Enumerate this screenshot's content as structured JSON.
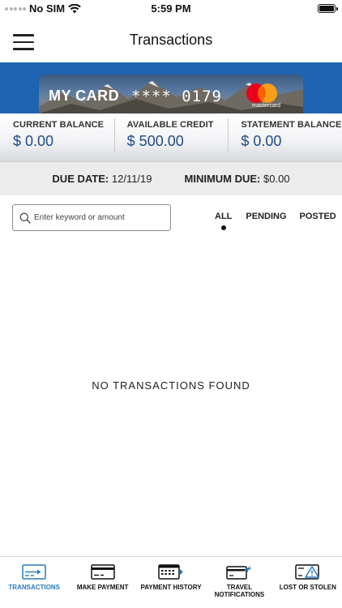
{
  "status_bar": {
    "carrier": "No SIM",
    "time": "5:59 PM"
  },
  "header": {
    "title": "Transactions"
  },
  "card": {
    "name": "MY CARD",
    "masked_prefix": "****",
    "last4": "0179",
    "network": "mastercard"
  },
  "balances": [
    {
      "label": "CURRENT BALANCE",
      "value": "$ 0.00"
    },
    {
      "label": "AVAILABLE CREDIT",
      "value": "$ 500.00"
    },
    {
      "label": "STATEMENT BALANCE",
      "value": "$ 0.00"
    }
  ],
  "due": {
    "due_date_label": "DUE DATE:",
    "due_date_value": "12/11/19",
    "minimum_due_label": "MINIMUM DUE:",
    "minimum_due_value": "$0.00"
  },
  "search": {
    "placeholder": "Enter keyword or amount"
  },
  "filters": {
    "all": "ALL",
    "pending": "PENDING",
    "posted": "POSTED",
    "selected": "ALL"
  },
  "empty_state": "NO TRANSACTIONS FOUND",
  "bottom_nav": [
    {
      "label": "TRANSACTIONS",
      "icon": "transactions-icon",
      "active": true
    },
    {
      "label": "MAKE PAYMENT",
      "icon": "card-payment-icon",
      "active": false
    },
    {
      "label": "PAYMENT HISTORY",
      "icon": "calendar-history-icon",
      "active": false
    },
    {
      "label": "TRAVEL NOTIFICATIONS",
      "icon": "airplane-card-icon",
      "active": false
    },
    {
      "label": "LOST OR STOLEN",
      "icon": "warning-card-icon",
      "active": false
    }
  ],
  "colors": {
    "banner_blue": "#1e64b0",
    "balance_value": "#1e4a86",
    "active_nav": "#2a7bbf"
  }
}
